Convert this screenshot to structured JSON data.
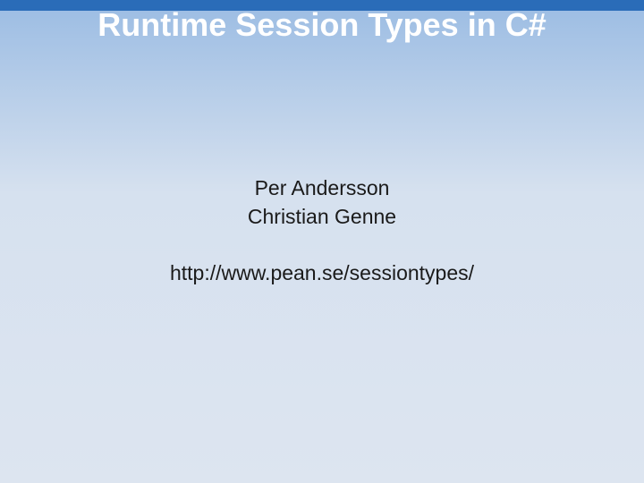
{
  "title": "Runtime Session Types in C#",
  "authors": [
    "Per Andersson",
    "Christian Genne"
  ],
  "url": "http://www.pean.se/sessiontypes/"
}
